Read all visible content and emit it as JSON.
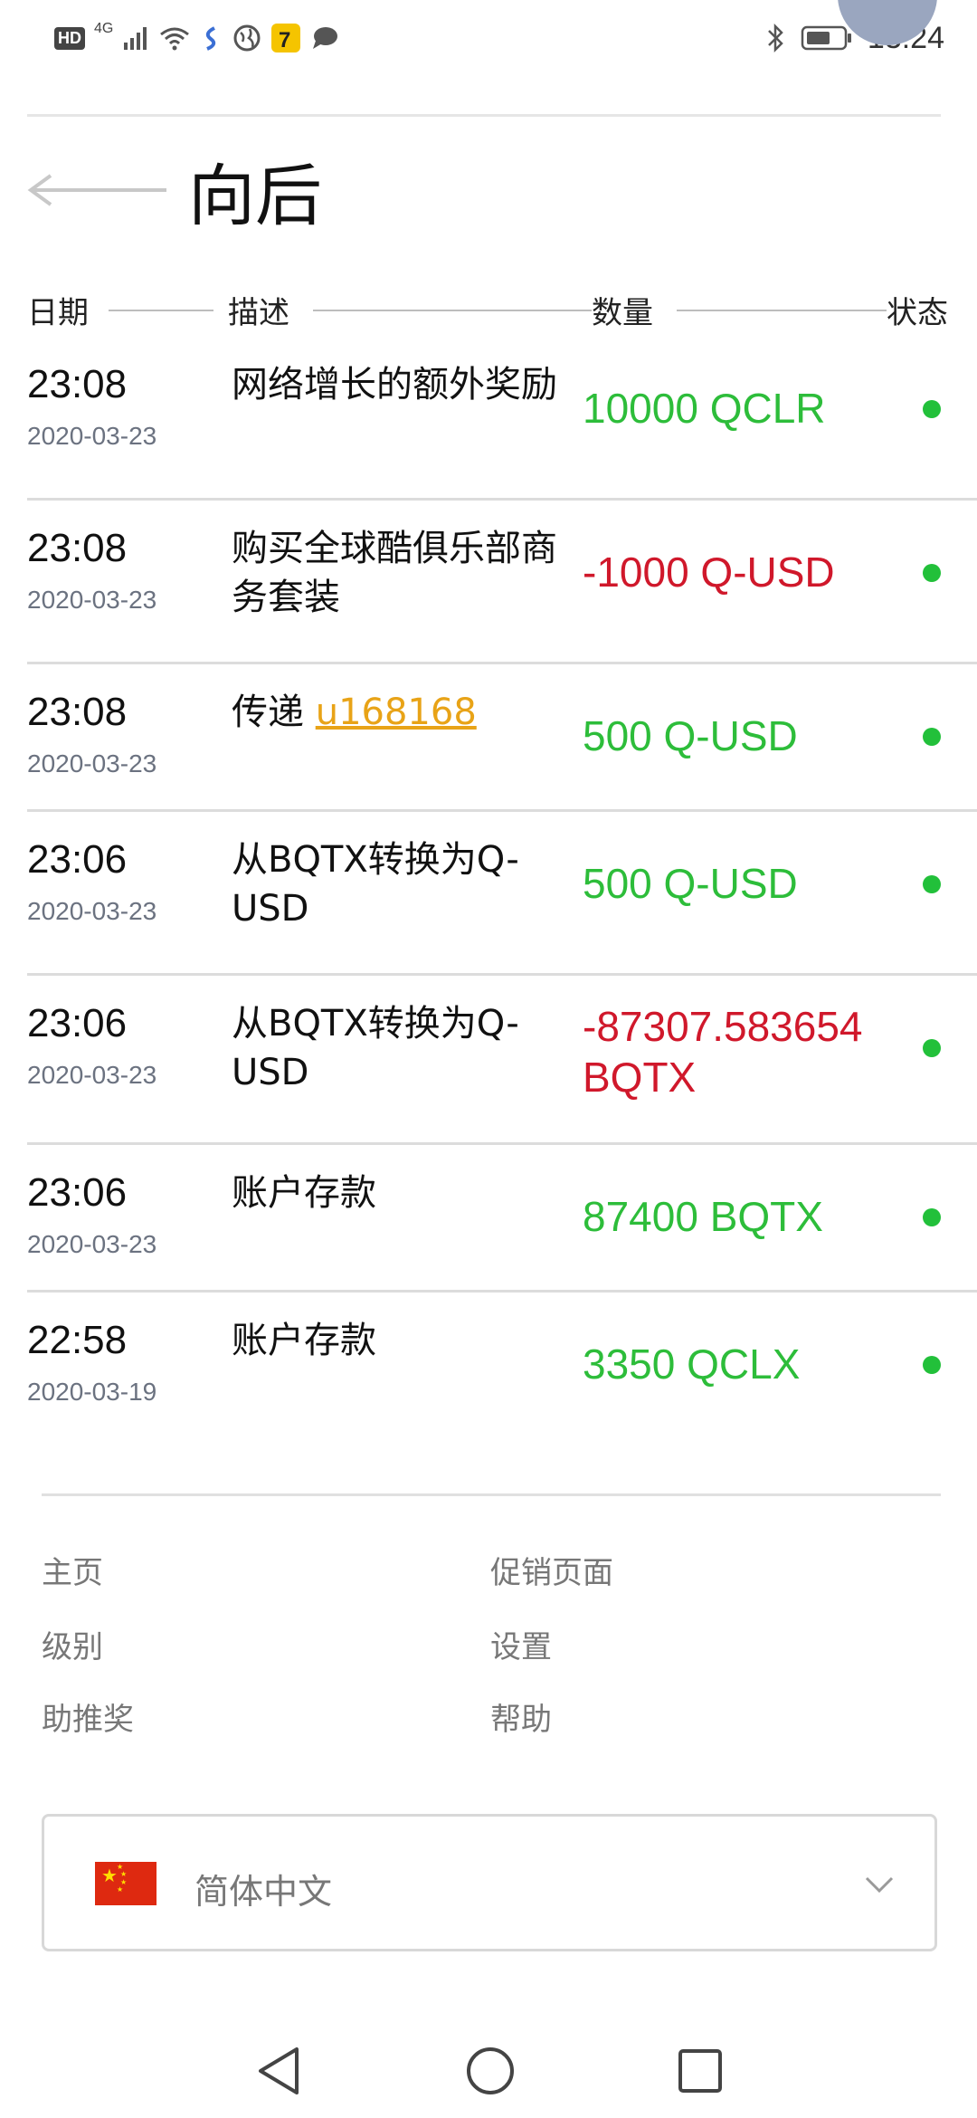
{
  "status_bar": {
    "hd": "HD",
    "network": "4G",
    "time": "13:24",
    "icons_left": [
      "hd-icon",
      "signal-icon",
      "wifi-icon",
      "app-icon",
      "globe-icon",
      "qq-app-icon",
      "chat-icon"
    ],
    "icons_right": [
      "bluetooth-icon",
      "battery-icon"
    ]
  },
  "header": {
    "back_label": "向后"
  },
  "table": {
    "columns": [
      "日期",
      "描述",
      "数量",
      "状态"
    ],
    "rows": [
      {
        "time": "23:08",
        "date": "2020-03-23",
        "desc": "网络增长的额外奖励",
        "amount": "10000 QCLR",
        "sign": "pos"
      },
      {
        "time": "23:08",
        "date": "2020-03-23",
        "desc": "购买全球酷俱乐部商务套装",
        "amount": "-1000 Q-USD",
        "sign": "neg"
      },
      {
        "time": "23:08",
        "date": "2020-03-23",
        "desc_prefix": "传递 ",
        "desc_link": "u168168",
        "amount": "500 Q-USD",
        "sign": "pos"
      },
      {
        "time": "23:06",
        "date": "2020-03-23",
        "desc": "从BQTX转换为Q-USD",
        "amount": "500 Q-USD",
        "sign": "pos"
      },
      {
        "time": "23:06",
        "date": "2020-03-23",
        "desc": "从BQTX转换为Q-USD",
        "amount": "-87307.583654 BQTX",
        "sign": "neg"
      },
      {
        "time": "23:06",
        "date": "2020-03-23",
        "desc": "账户存款",
        "amount": "87400 BQTX",
        "sign": "pos"
      },
      {
        "time": "22:58",
        "date": "2020-03-19",
        "desc": "账户存款",
        "amount": "3350 QCLX",
        "sign": "pos"
      }
    ]
  },
  "footer": {
    "links": [
      "主页",
      "促销页面",
      "级别",
      "设置",
      "助推奖",
      "帮助"
    ],
    "language": {
      "flag_icon": "china-flag-icon",
      "label": "简体中文"
    }
  },
  "colors": {
    "positive": "#2dbd3a",
    "negative": "#d0182b",
    "link": "#e8a317",
    "status": "#22c03a"
  },
  "nav": {
    "icons": [
      "back-triangle-icon",
      "home-circle-icon",
      "recents-square-icon"
    ]
  }
}
